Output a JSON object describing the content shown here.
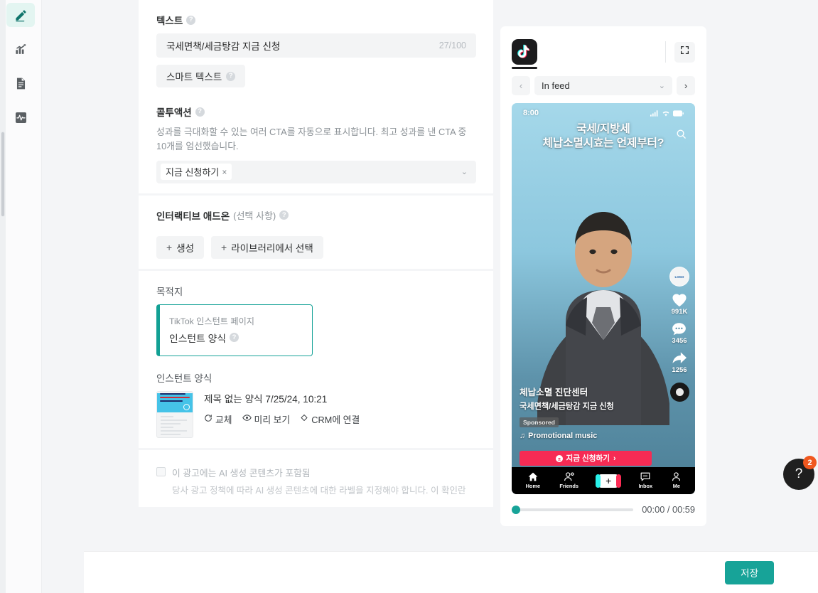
{
  "sidebar": {
    "items": [
      {
        "name": "edit",
        "icon": "pencil-icon",
        "active": true
      },
      {
        "name": "analytics",
        "icon": "chart-growth-icon",
        "active": false
      },
      {
        "name": "document",
        "icon": "document-icon",
        "active": false
      },
      {
        "name": "activity",
        "icon": "pulse-icon",
        "active": false
      }
    ]
  },
  "form": {
    "text_section": {
      "label": "텍스트",
      "value": "국세면책/세금탕감 지금 신청",
      "counter": "27/100",
      "smart_text_button": "스마트 텍스트"
    },
    "cta_section": {
      "label": "콜투액션",
      "description": "성과를 극대화할 수 있는 여러 CTA를 자동으로 표시합니다. 최고 성과를 낸 CTA 중 10개를 엄선했습니다.",
      "selected_tag": "지금 신청하기",
      "remove_symbol": "×"
    },
    "addon_section": {
      "label": "인터랙티브 애드온",
      "optional": "(선택 사항)",
      "create_button": "생성",
      "library_button": "라이브러리에서 선택",
      "plus": "+"
    },
    "destination_section": {
      "label": "목적지",
      "option_sub": "TikTok 인스턴트 페이지",
      "option_title": "인스턴트 양식"
    },
    "instant_form_section": {
      "label": "인스턴트 양식",
      "form_name": "제목 없는 양식 7/25/24, 10:21",
      "actions": [
        {
          "label": "교체",
          "icon": "refresh-icon"
        },
        {
          "label": "미리 보기",
          "icon": "eye-icon"
        },
        {
          "label": "CRM에 연결",
          "icon": "link-crm-icon"
        }
      ]
    },
    "ai_disclosure": {
      "checkbox_label": "이 광고에는 AI 생성 콘텐츠가 포함됨",
      "note": "당사 광고 정책에 따라 AI 생성 콘텐츠에 대한 라벨을 지정해야 합니다. 이 확인란"
    }
  },
  "preview": {
    "placement_select": "In feed",
    "prev_arrow": "‹",
    "next_arrow": "›",
    "video": {
      "status_time": "8:00",
      "title_line1": "국세/지방세",
      "title_line2": "체납소멸시효는 언제부터?",
      "brand": "체납소멸 진단센터",
      "description": "국세면책/세금탕감 지금 신청",
      "sponsored": "Sponsored",
      "music": "Promotional music",
      "music_note": "♫",
      "cta": "지금 신청하기",
      "cta_arrow": "›",
      "likes": "991K",
      "comments": "3456",
      "shares": "1256"
    },
    "tabbar": [
      {
        "label": "Home",
        "icon": "home-icon"
      },
      {
        "label": "Friends",
        "icon": "friends-icon"
      },
      {
        "label": "",
        "icon": "plus-icon"
      },
      {
        "label": "Inbox",
        "icon": "inbox-icon"
      },
      {
        "label": "Me",
        "icon": "person-icon"
      }
    ],
    "seek": {
      "time": "00:00 / 00:59"
    }
  },
  "footer": {
    "save_label": "저장"
  },
  "help": {
    "glyph": "?",
    "badge": "2"
  },
  "colors": {
    "accent_teal": "#17a398",
    "cta_red": "#f62b54",
    "badge_orange": "#f0581f"
  }
}
